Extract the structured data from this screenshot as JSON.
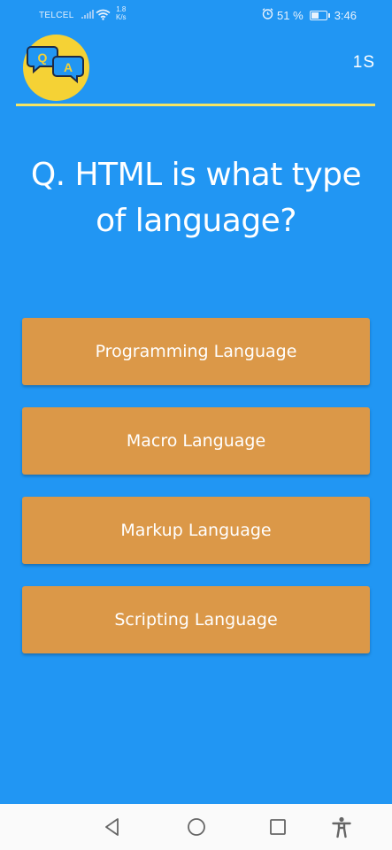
{
  "status_bar": {
    "carrier": "TELCEL",
    "net_speed_value": "1.8",
    "net_speed_unit": "K/s",
    "battery_percent": "51 %",
    "battery_level": 0.51,
    "time": "3:46"
  },
  "header": {
    "logo_letter_q": "Q",
    "logo_letter_a": "A",
    "timer": "1S",
    "logo_color": "#F5D235",
    "divider_color": "#F5E463"
  },
  "question": {
    "text": "Q. HTML is what type of language?"
  },
  "options": [
    {
      "label": "Programming Language"
    },
    {
      "label": "Macro Language"
    },
    {
      "label": "Markup Language"
    },
    {
      "label": "Scripting Language"
    }
  ],
  "colors": {
    "background": "#2196F3",
    "option_background": "#DB9848",
    "nav_background": "#fafafa"
  },
  "nav_bar": {
    "icons": [
      "back-icon",
      "home-icon",
      "recents-icon",
      "accessibility-icon"
    ]
  }
}
